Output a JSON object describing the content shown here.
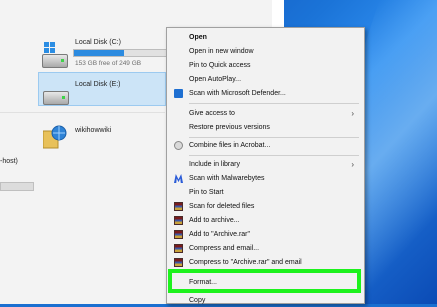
{
  "explorer": {
    "drives": [
      {
        "label": "Local Disk (C:)",
        "sub": "153 GB free of 249 GB",
        "used_fraction": 0.39
      },
      {
        "label": "Local Disk (E:)"
      }
    ],
    "network_item": "wikihowwiki",
    "host_fragment": "-host)"
  },
  "menu": {
    "items": [
      {
        "label": "Open",
        "bold": true
      },
      {
        "label": "Open in new window"
      },
      {
        "label": "Pin to Quick access"
      },
      {
        "label": "Open AutoPlay..."
      },
      {
        "label": "Scan with Microsoft Defender...",
        "icon": "defender-icon"
      },
      {
        "label": "Give access to",
        "submenu": true
      },
      {
        "label": "Restore previous versions"
      },
      {
        "label": "Combine files in Acrobat...",
        "icon": "acrobat-icon"
      },
      {
        "label": "Include in library",
        "submenu": true
      },
      {
        "label": "Scan with Malwarebytes",
        "icon": "malwarebytes-icon"
      },
      {
        "label": "Pin to Start"
      },
      {
        "label": "Scan for deleted files",
        "icon": "recovery-icon"
      },
      {
        "label": "Add to archive...",
        "icon": "winrar-icon"
      },
      {
        "label": "Add to \"Archive.rar\"",
        "icon": "winrar-icon"
      },
      {
        "label": "Compress and email...",
        "icon": "winrar-icon"
      },
      {
        "label": "Compress to \"Archive.rar\" and email",
        "icon": "winrar-icon"
      },
      {
        "label": "Format..."
      },
      {
        "label": "Copy"
      }
    ],
    "highlight_color": "#1df21d"
  },
  "colors": {
    "selection": "#cce4f7",
    "accent": "#2c8be0"
  }
}
